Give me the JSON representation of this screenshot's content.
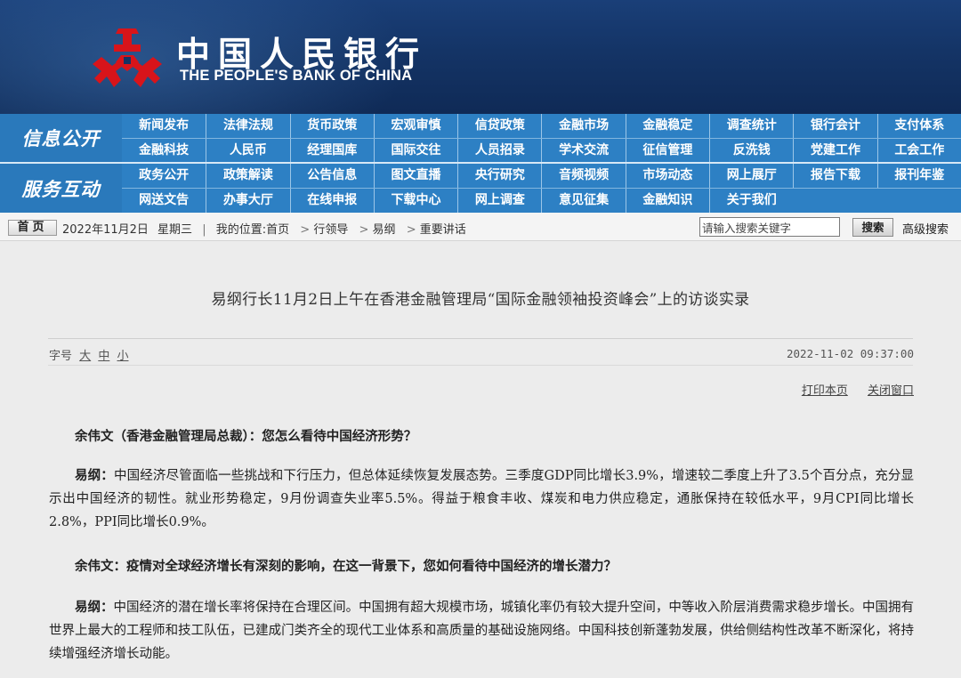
{
  "header": {
    "logo_cn": "中国人民银行",
    "logo_en": "THE PEOPLE'S BANK OF CHINA"
  },
  "nav": {
    "group1_title": "信息公开",
    "group1_row1": [
      "新闻发布",
      "法律法规",
      "货币政策",
      "宏观审慎",
      "信贷政策",
      "金融市场",
      "金融稳定",
      "调查统计",
      "银行会计",
      "支付体系"
    ],
    "group1_row2": [
      "金融科技",
      "人民币",
      "经理国库",
      "国际交往",
      "人员招录",
      "学术交流",
      "征信管理",
      "反洗钱",
      "党建工作",
      "工会工作"
    ],
    "group2_title": "服务互动",
    "group2_row1": [
      "政务公开",
      "政策解读",
      "公告信息",
      "图文直播",
      "央行研究",
      "音频视频",
      "市场动态",
      "网上展厅",
      "报告下载",
      "报刊年鉴"
    ],
    "group2_row2": [
      "网送文告",
      "办事大厅",
      "在线申报",
      "下载中心",
      "网上调查",
      "意见征集",
      "金融知识",
      "关于我们"
    ]
  },
  "breadcrumb": {
    "home": "首页",
    "date": "2022年11月2日",
    "weekday": "星期三",
    "location_label": "我的位置:",
    "path": [
      "首页",
      "行领导",
      "易纲",
      "重要讲话"
    ],
    "search_placeholder": "请输入搜索关键字",
    "search_button": "搜索",
    "advanced_search": "高级搜索"
  },
  "article": {
    "title": "易纲行长11月2日上午在香港金融管理局“国际金融领袖投资峰会”上的访谈实录",
    "fontsize_label": "字号",
    "fontsize_options": [
      "大",
      "中",
      "小"
    ],
    "datetime": "2022-11-02 09:37:00",
    "print_link": "打印本页",
    "close_link": "关闭窗口",
    "q1": "余伟文（香港金融管理局总裁）：您怎么看待中国经济形势？",
    "a1_speaker": "易纲：",
    "a1_text": "中国经济尽管面临一些挑战和下行压力，但总体延续恢复发展态势。三季度GDP同比增长3.9%，增速较二季度上升了3.5个百分点，充分显示出中国经济的韧性。就业形势稳定，9月份调查失业率5.5%。得益于粮食丰收、煤炭和电力供应稳定，通胀保持在较低水平，9月CPI同比增长2.8%，PPI同比增长0.9%。",
    "q2": "余伟文：疫情对全球经济增长有深刻的影响，在这一背景下，您如何看待中国经济的增长潜力？",
    "a2_speaker": "易纲：",
    "a2_text": "中国经济的潜在增长率将保持在合理区间。中国拥有超大规模市场，城镇化率仍有较大提升空间，中等收入阶层消费需求稳步增长。中国拥有世界上最大的工程师和技工队伍，已建成门类齐全的现代工业体系和高质量的基础设施网络。中国科技创新蓬勃发展，供给侧结构性改革不断深化，将持续增强经济增长动能。"
  },
  "colors": {
    "header_bg": "#143466",
    "nav_bg": "#2d80c4",
    "emblem_red": "#d8141a"
  }
}
